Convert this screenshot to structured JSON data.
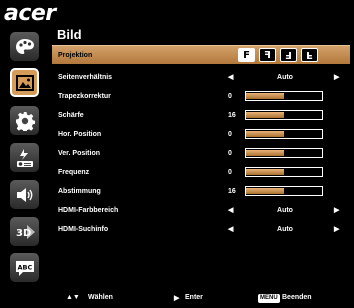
{
  "brand": "acer",
  "page_title": "Bild",
  "sidebar": [
    {
      "icon": "palette-icon",
      "active": false
    },
    {
      "icon": "picture-icon",
      "active": true
    },
    {
      "icon": "gear-icon",
      "active": false
    },
    {
      "icon": "power-management-icon",
      "active": false
    },
    {
      "icon": "speaker-icon",
      "active": false
    },
    {
      "icon": "3d-icon",
      "label": "3D",
      "active": false
    },
    {
      "icon": "language-icon",
      "label": "ABC",
      "active": false
    }
  ],
  "rows": [
    {
      "label": "Projektion",
      "type": "projection",
      "selected": true,
      "options": [
        "F",
        "F",
        "F",
        "F"
      ]
    },
    {
      "label": "Seitenverhältnis",
      "type": "select",
      "value": "Auto"
    },
    {
      "label": "Trapezkorrektur",
      "type": "slider",
      "value": "0",
      "level": 0.5
    },
    {
      "label": "Schärfe",
      "type": "slider",
      "value": "16",
      "level": 0.5
    },
    {
      "label": "Hor. Position",
      "type": "slider",
      "value": "0",
      "level": 0.5
    },
    {
      "label": "Ver. Position",
      "type": "slider",
      "value": "0",
      "level": 0.5
    },
    {
      "label": "Frequenz",
      "type": "slider",
      "value": "0",
      "level": 0.5
    },
    {
      "label": "Abstimmung",
      "type": "slider",
      "value": "16",
      "level": 0.5
    },
    {
      "label": "HDMI-Farbbereich",
      "type": "select",
      "value": "Auto"
    },
    {
      "label": "HDMI-Suchinfo",
      "type": "select",
      "value": "Auto"
    }
  ],
  "footer": {
    "nav_arrows": "▲▼",
    "nav_label": "Wählen",
    "enter_arrow": "▶",
    "enter_label": "Enter",
    "menu_key": "MENU",
    "exit_label": "Beenden"
  },
  "colors": {
    "accent": "#d59b58",
    "slider_fill": "#c98b4a",
    "background": "#000000"
  }
}
